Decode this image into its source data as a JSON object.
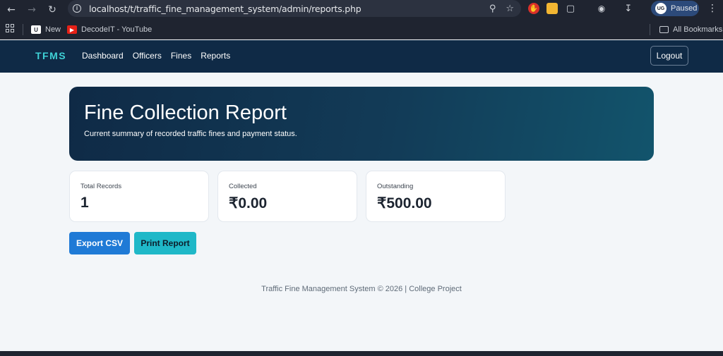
{
  "browser": {
    "url": "localhost/t/traffic_fine_management_system/admin/reports.php",
    "profile_label": "Paused",
    "profile_initials": "UG",
    "bookmarks": [
      {
        "label": "New"
      },
      {
        "label": "DecodeIT - YouTube"
      }
    ],
    "all_bookmarks_label": "All Bookmarks"
  },
  "nav": {
    "brand": "TFMS",
    "links": [
      "Dashboard",
      "Officers",
      "Fines",
      "Reports"
    ],
    "logout_label": "Logout"
  },
  "hero": {
    "title": "Fine Collection Report",
    "subtitle": "Current summary of recorded traffic fines and payment status."
  },
  "stats": [
    {
      "label": "Total Records",
      "value": "1"
    },
    {
      "label": "Collected",
      "value": "₹0.00"
    },
    {
      "label": "Outstanding",
      "value": "₹500.00"
    }
  ],
  "actions": {
    "export_label": "Export CSV",
    "print_label": "Print Report"
  },
  "footer": {
    "text": "Traffic Fine Management System © 2026 | College Project"
  },
  "colors": {
    "navbar": "#0f2a46",
    "brand": "#3fd1d6",
    "export_button": "#1f7ad6",
    "print_button": "#1fb8c8"
  }
}
